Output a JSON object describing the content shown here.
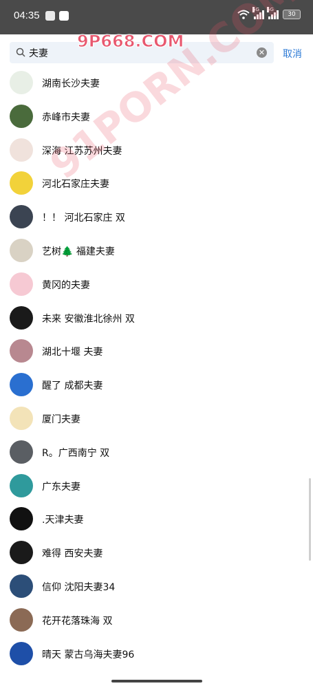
{
  "status_bar": {
    "time": "04:35",
    "network_1": "5G",
    "network_2": "5G",
    "battery": "30"
  },
  "search": {
    "query": "夫妻",
    "cancel_label": "取消"
  },
  "watermarks": [
    "9P668.COM",
    "91PORN.COM"
  ],
  "results": [
    {
      "name": "湖南长沙夫妻",
      "avatar_color": "#e8efe6"
    },
    {
      "name": "赤峰市夫妻",
      "avatar_color": "#4a6b3c"
    },
    {
      "name": "深海 江苏苏州夫妻",
      "avatar_color": "#f0e2dc"
    },
    {
      "name": "河北石家庄夫妻",
      "avatar_color": "#f2d23a"
    },
    {
      "name": "！！ 河北石家庄 双",
      "avatar_color": "#3b4452"
    },
    {
      "name": "艺树🌲 福建夫妻",
      "avatar_color": "#d9d2c4"
    },
    {
      "name": "黄冈的夫妻",
      "avatar_color": "#f6c9d3"
    },
    {
      "name": "未来 安徽淮北徐州 双",
      "avatar_color": "#1a1a1a"
    },
    {
      "name": "湖北十堰 夫妻",
      "avatar_color": "#b88890"
    },
    {
      "name": "醒了 成都夫妻",
      "avatar_color": "#2a6fd0"
    },
    {
      "name": "厦门夫妻",
      "avatar_color": "#f3e3b8"
    },
    {
      "name": "R。广西南宁 双",
      "avatar_color": "#5a5e63"
    },
    {
      "name": "广东夫妻",
      "avatar_color": "#2f9a9c"
    },
    {
      "name": ".天津夫妻",
      "avatar_color": "#111111"
    },
    {
      "name": "难得  西安夫妻",
      "avatar_color": "#1a1a1a"
    },
    {
      "name": "信仰 沈阳夫妻34",
      "avatar_color": "#2c4e78"
    },
    {
      "name": "花开花落珠海 双",
      "avatar_color": "#8b6a55"
    },
    {
      "name": "晴天  蒙古乌海夫妻96",
      "avatar_color": "#1e4fa8"
    }
  ]
}
